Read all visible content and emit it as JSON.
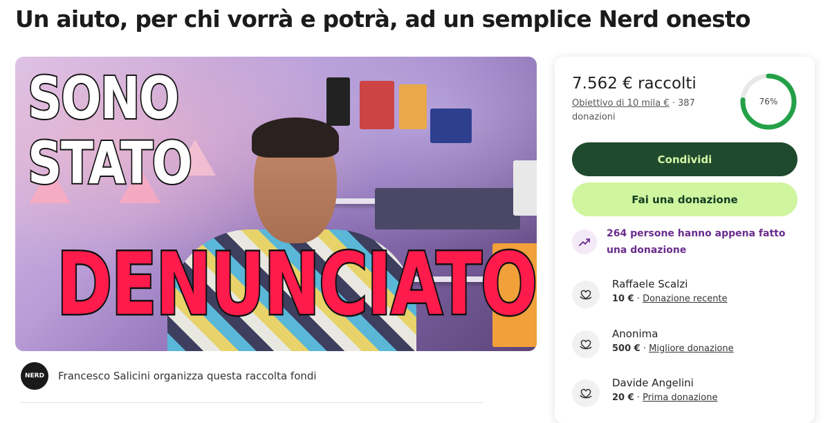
{
  "page": {
    "title": "Un aiuto, per chi vorrà e potrà, ad un semplice Nerd onesto"
  },
  "hero": {
    "line1": "SONO",
    "line2": "STATO",
    "line3": "DENUNCIATO"
  },
  "organizer": {
    "avatar_text": "NERD",
    "text": "Francesco Salicini organizza questa raccolta fondi"
  },
  "donation": {
    "raised": "7.562 € raccolti",
    "goal_link": "Obiettivo di 10 mila €",
    "separator": "·",
    "donations_count": "387",
    "donations_label": "donazioni",
    "progress_percent": 76,
    "progress_label": "76%",
    "share_label": "Condividi",
    "donate_label": "Fai una donazione",
    "recent_activity": "264 persone hanno appena fatto una donazione",
    "accent_color": "#1f4a2e",
    "progress_color": "#24a148",
    "donors": [
      {
        "name": "Raffaele Scalzi",
        "amount": "10 €",
        "tag": "Donazione recente"
      },
      {
        "name": "Anonima",
        "amount": "500 €",
        "tag": "Migliore donazione"
      },
      {
        "name": "Davide Angelini",
        "amount": "20 €",
        "tag": "Prima donazione"
      }
    ]
  }
}
